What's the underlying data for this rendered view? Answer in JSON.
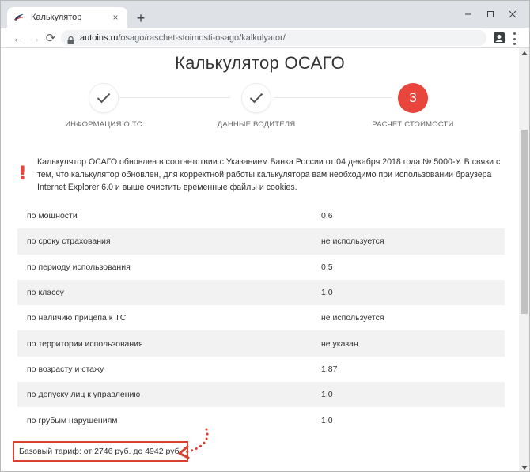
{
  "browser": {
    "tab_title": "Калькулятор",
    "tab_close": "×",
    "new_tab": "+",
    "url_host": "autoins.ru",
    "url_path": "/osago/raschet-stoimosti-osago/kalkulyator/",
    "nav": {
      "back": "←",
      "forward": "→",
      "reload": "⟳"
    }
  },
  "page": {
    "title": "Калькулятор ОСАГО",
    "steps": [
      {
        "label": "ИНФОРМАЦИЯ О ТС",
        "state": "done",
        "icon": "check-icon"
      },
      {
        "label": "ДАННЫЕ ВОДИТЕЛЯ",
        "state": "done",
        "icon": "check-icon"
      },
      {
        "label": "РАСЧЕТ СТОИМОСТИ",
        "state": "active",
        "number": "3"
      }
    ],
    "notice_mark": "!",
    "notice": "Калькулятор ОСАГО обновлен в соответствии с Указанием Банка России от 04 декабря 2018 года № 5000-У. В связи с тем, что калькулятор обновлен, для корректной работы калькулятора вам необходимо при использовании браузера Internet Explorer 6.0 и выше очистить временные файлы и cookies.",
    "coefficients": [
      {
        "label": "по мощности",
        "value": "0.6"
      },
      {
        "label": "по сроку страхования",
        "value": "не используется"
      },
      {
        "label": "по периоду использования",
        "value": "0.5"
      },
      {
        "label": "по классу",
        "value": "1.0"
      },
      {
        "label": "по наличию прицепа к ТС",
        "value": "не используется"
      },
      {
        "label": "по территории использования",
        "value": "не указан"
      },
      {
        "label": "по возрасту и стажу",
        "value": "1.87"
      },
      {
        "label": "по допуску лиц к управлению",
        "value": "1.0"
      },
      {
        "label": "по грубым нарушениям",
        "value": "1.0"
      }
    ],
    "base_rate": "Базовый тариф: от 2746 руб. до 4942 руб."
  },
  "colors": {
    "accent": "#e8453c",
    "highlight_border": "#d9402f",
    "stripe": "#f2f2f2"
  }
}
